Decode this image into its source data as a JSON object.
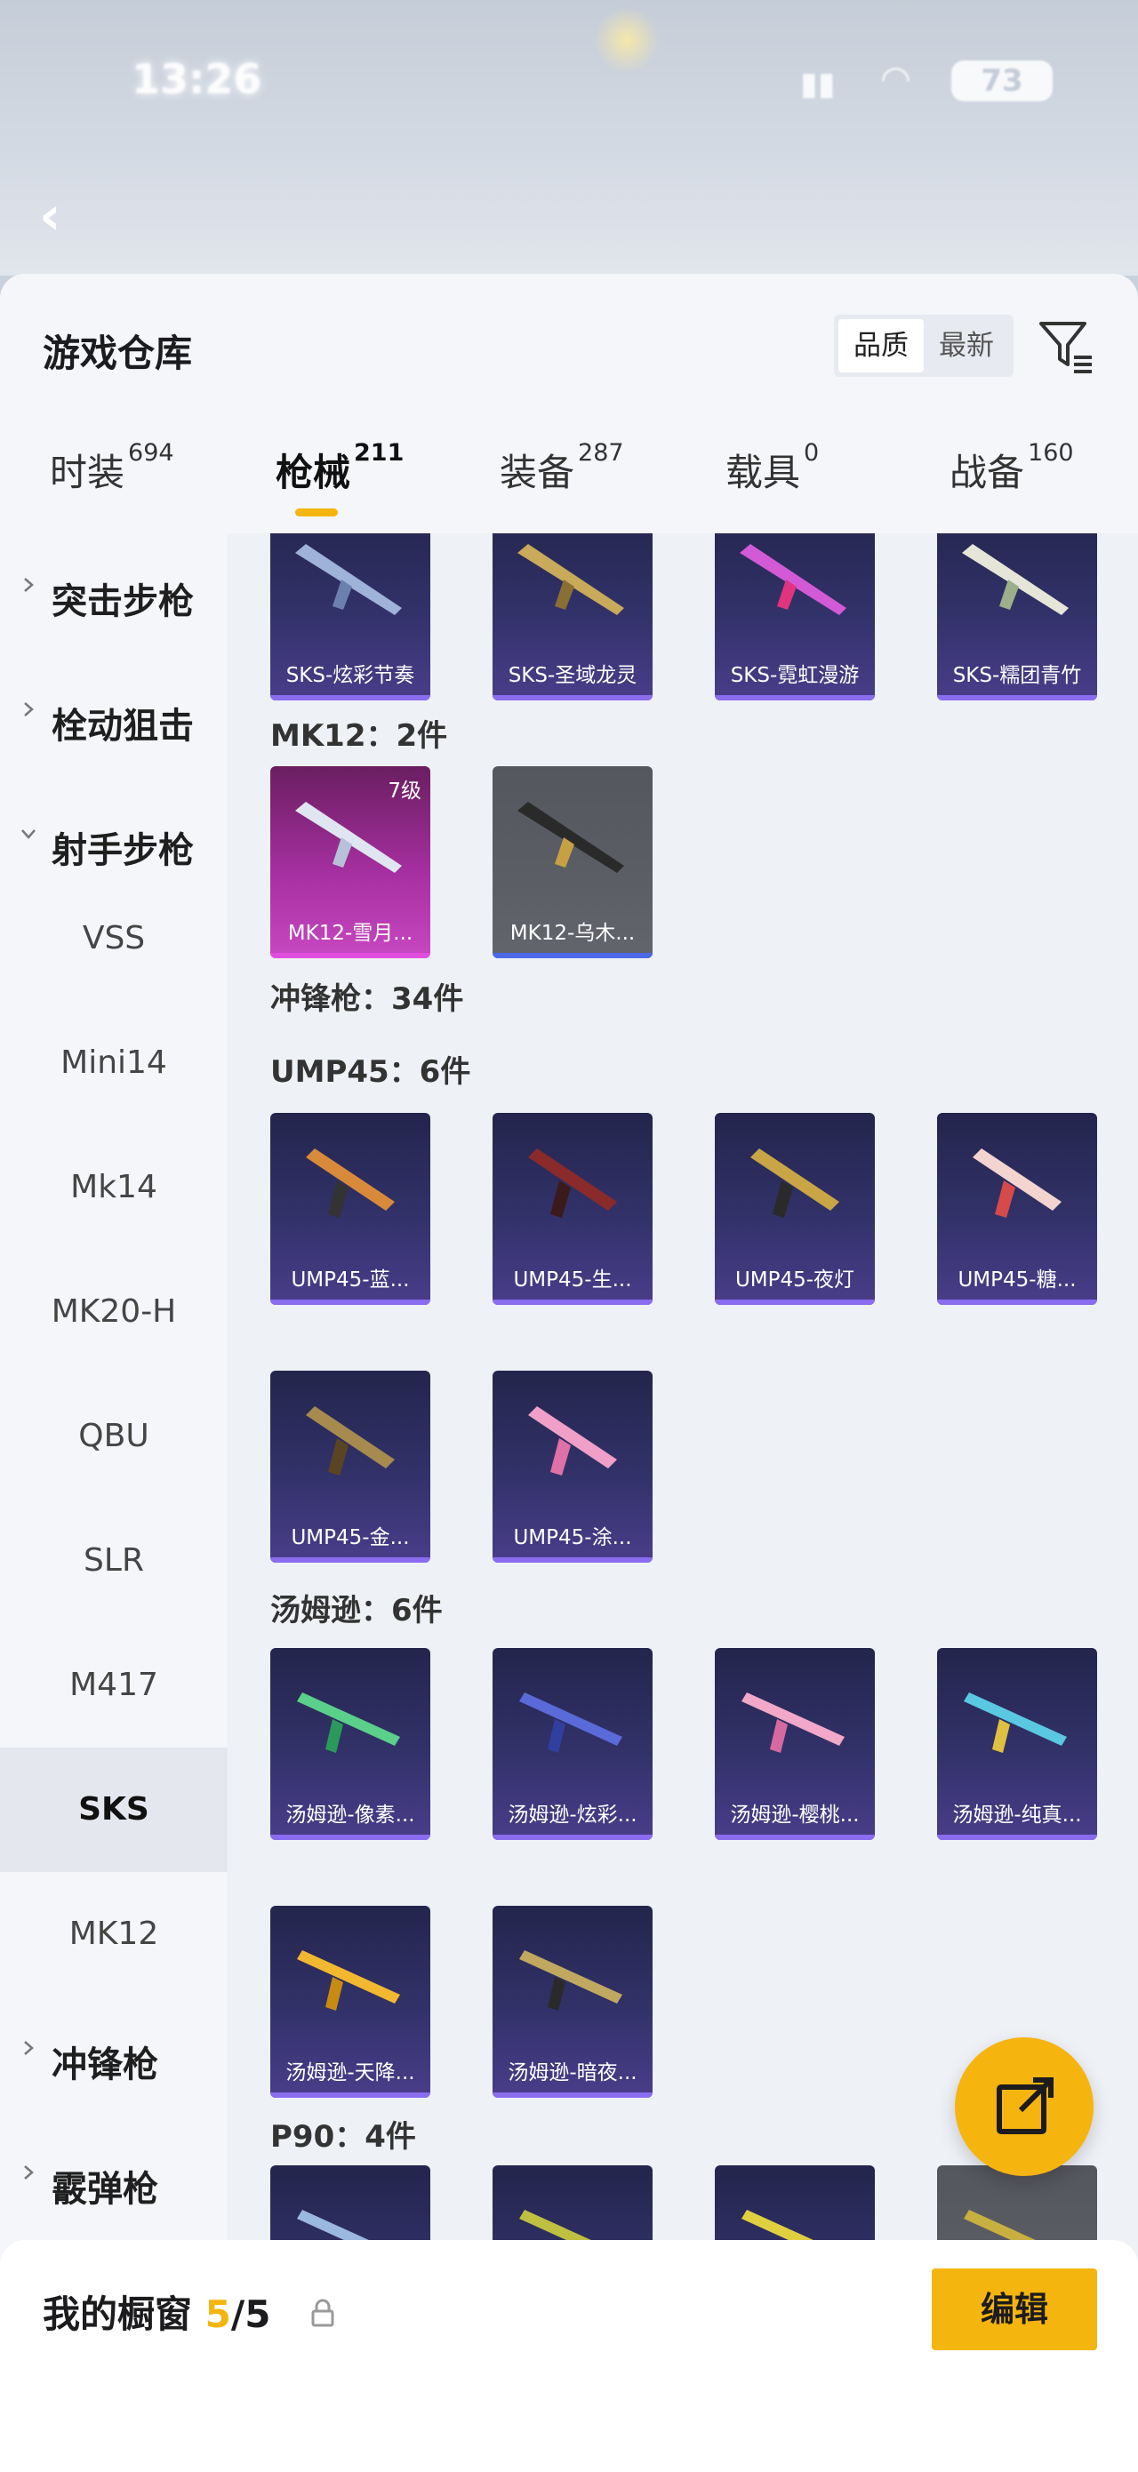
{
  "status_bar": {
    "time": "13:26",
    "battery": "73"
  },
  "header": {
    "title": "游戏仓库",
    "sort": [
      "品质",
      "最新"
    ],
    "sort_active": 0
  },
  "tabs": [
    {
      "label": "时装",
      "count": "694"
    },
    {
      "label": "枪械",
      "count": "211"
    },
    {
      "label": "装备",
      "count": "287"
    },
    {
      "label": "载具",
      "count": "0"
    },
    {
      "label": "战备",
      "count": "160"
    }
  ],
  "active_tab": 1,
  "sidebar": {
    "categories": [
      {
        "label": "突击步枪",
        "expanded": false
      },
      {
        "label": "栓动狙击",
        "expanded": false
      },
      {
        "label": "射手步枪",
        "expanded": true
      }
    ],
    "subs": [
      "VSS",
      "Mini14",
      "Mk14",
      "MK20-H",
      "QBU",
      "SLR",
      "M417",
      "SKS",
      "MK12"
    ],
    "active_sub": "SKS",
    "more_categories": [
      {
        "label": "冲锋枪",
        "expanded": false
      },
      {
        "label": "霰弹枪",
        "expanded": false
      }
    ]
  },
  "content": {
    "row_sks": [
      "SKS-炫彩节奏",
      "SKS-圣域龙灵",
      "SKS-霓虹漫游",
      "SKS-糯团青竹"
    ],
    "mk12_header": "MK12：2件",
    "mk12": [
      {
        "name": "MK12-雪月...",
        "level": "7级",
        "style": "pink"
      },
      {
        "name": "MK12-乌木...",
        "style": "grey"
      }
    ],
    "smg_header": "冲锋枪：34件",
    "ump_header": "UMP45：6件",
    "ump": [
      "UMP45-蓝...",
      "UMP45-生...",
      "UMP45-夜灯",
      "UMP45-糖...",
      "UMP45-金...",
      "UMP45-涂..."
    ],
    "tommy_header": "汤姆逊：6件",
    "tommy": [
      "汤姆逊-像素...",
      "汤姆逊-炫彩...",
      "汤姆逊-樱桃...",
      "汤姆逊-纯真...",
      "汤姆逊-天降...",
      "汤姆逊-暗夜..."
    ],
    "p90_header": "P90：4件"
  },
  "bottom": {
    "label": "我的橱窗",
    "count_current": "5",
    "count_total": "/5",
    "edit_label": "编辑"
  },
  "colors": {
    "accent": "#f5b50f",
    "card_bg": "#2b2c5c",
    "card_bar": "#8a6cf0"
  },
  "icons": [
    "back-icon",
    "filter-icon",
    "chevron-right-icon",
    "chevron-down-icon",
    "lock-icon",
    "share-icon"
  ]
}
